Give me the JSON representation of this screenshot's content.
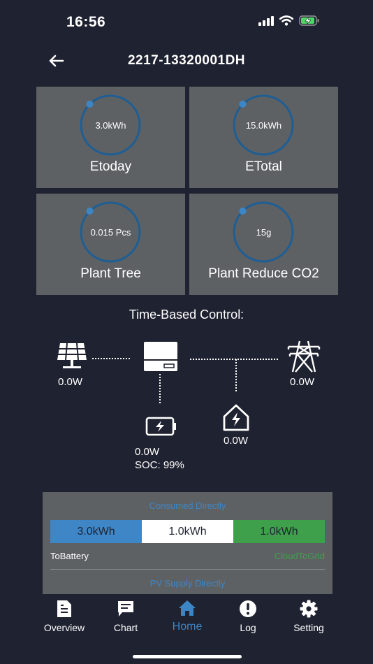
{
  "status_bar": {
    "time": "16:56",
    "icons": [
      "cellular-signal-icon",
      "wifi-icon",
      "battery-charging-icon"
    ]
  },
  "header": {
    "back_icon": "arrow-left-icon",
    "title": "2217-13320001DH"
  },
  "cards": [
    {
      "value": "3.0kWh",
      "label": "Etoday"
    },
    {
      "value": "15.0kWh",
      "label": "ETotal"
    },
    {
      "value": "0.015 Pcs",
      "label": "Plant Tree"
    },
    {
      "value": "15g",
      "label": "Plant Reduce CO2"
    }
  ],
  "time_based_control": {
    "title": "Time-Based Control:",
    "solar": {
      "icon": "solar-panel-icon",
      "power": "0.0W"
    },
    "inverter": {
      "icon": "inverter-icon"
    },
    "grid": {
      "icon": "power-tower-icon",
      "power": "0.0W"
    },
    "battery": {
      "icon": "battery-icon",
      "power": "0.0W",
      "soc": "SOC: 99%"
    },
    "home": {
      "icon": "home-power-icon",
      "power": "0.0W"
    }
  },
  "energy_panel": {
    "consumed_label": "Consumed Directly",
    "segments": [
      "3.0kWh",
      "1.0kWh",
      "1.0kWh"
    ],
    "to_battery": "ToBattery",
    "cloud_to_grid": "CloudToGrid",
    "pv_label": "PV Supply Directly",
    "colors": {
      "blue": "#3f86c6",
      "white": "#ffffff",
      "green": "#3ea04a"
    }
  },
  "nav": {
    "items": [
      {
        "label": "Overview",
        "icon": "document-icon"
      },
      {
        "label": "Chart",
        "icon": "chat-bubble-icon"
      },
      {
        "label": "Home",
        "icon": "home-icon",
        "active": true
      },
      {
        "label": "Log",
        "icon": "alert-icon"
      },
      {
        "label": "Setting",
        "icon": "gear-icon"
      }
    ]
  },
  "colors": {
    "background": "#1f2230",
    "card": "#5e6164",
    "accent": "#3d86c6"
  }
}
